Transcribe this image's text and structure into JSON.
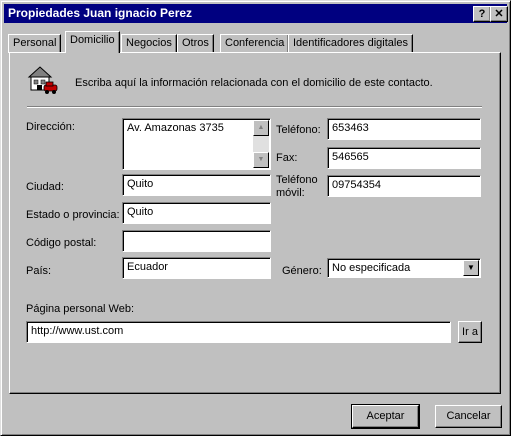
{
  "window": {
    "title": "Propiedades Juan ignacio Perez",
    "help_label": "?",
    "close_label": "✕"
  },
  "tabs": [
    {
      "label": "Personal"
    },
    {
      "label": "Domicilio"
    },
    {
      "label": "Negocios"
    },
    {
      "label": "Otros"
    },
    {
      "label": "Conferencia"
    },
    {
      "label": "Identificadores digitales"
    }
  ],
  "info": {
    "text": "Escriba aquí la información relacionada con el domicilio de este contacto."
  },
  "form": {
    "direccion": {
      "label": "Dirección:",
      "value": "Av. Amazonas 3735"
    },
    "ciudad": {
      "label": "Ciudad:",
      "value": "Quito"
    },
    "estado": {
      "label": "Estado o provincia:",
      "value": "Quito"
    },
    "codigo": {
      "label": "Código postal:",
      "value": ""
    },
    "pais": {
      "label": "País:",
      "value": "Ecuador"
    },
    "telefono": {
      "label": "Teléfono:",
      "value": "653463"
    },
    "fax": {
      "label": "Fax:",
      "value": "546565"
    },
    "movil": {
      "label_line1": "Teléfono",
      "label_line2": "móvil:",
      "value": "09754354"
    },
    "genero": {
      "label": "Género:",
      "value": "No especificada"
    },
    "web": {
      "label": "Página personal Web:",
      "value": "http://www.ust.com",
      "go_label": "Ir a"
    }
  },
  "buttons": {
    "ok": "Aceptar",
    "cancel": "Cancelar"
  }
}
